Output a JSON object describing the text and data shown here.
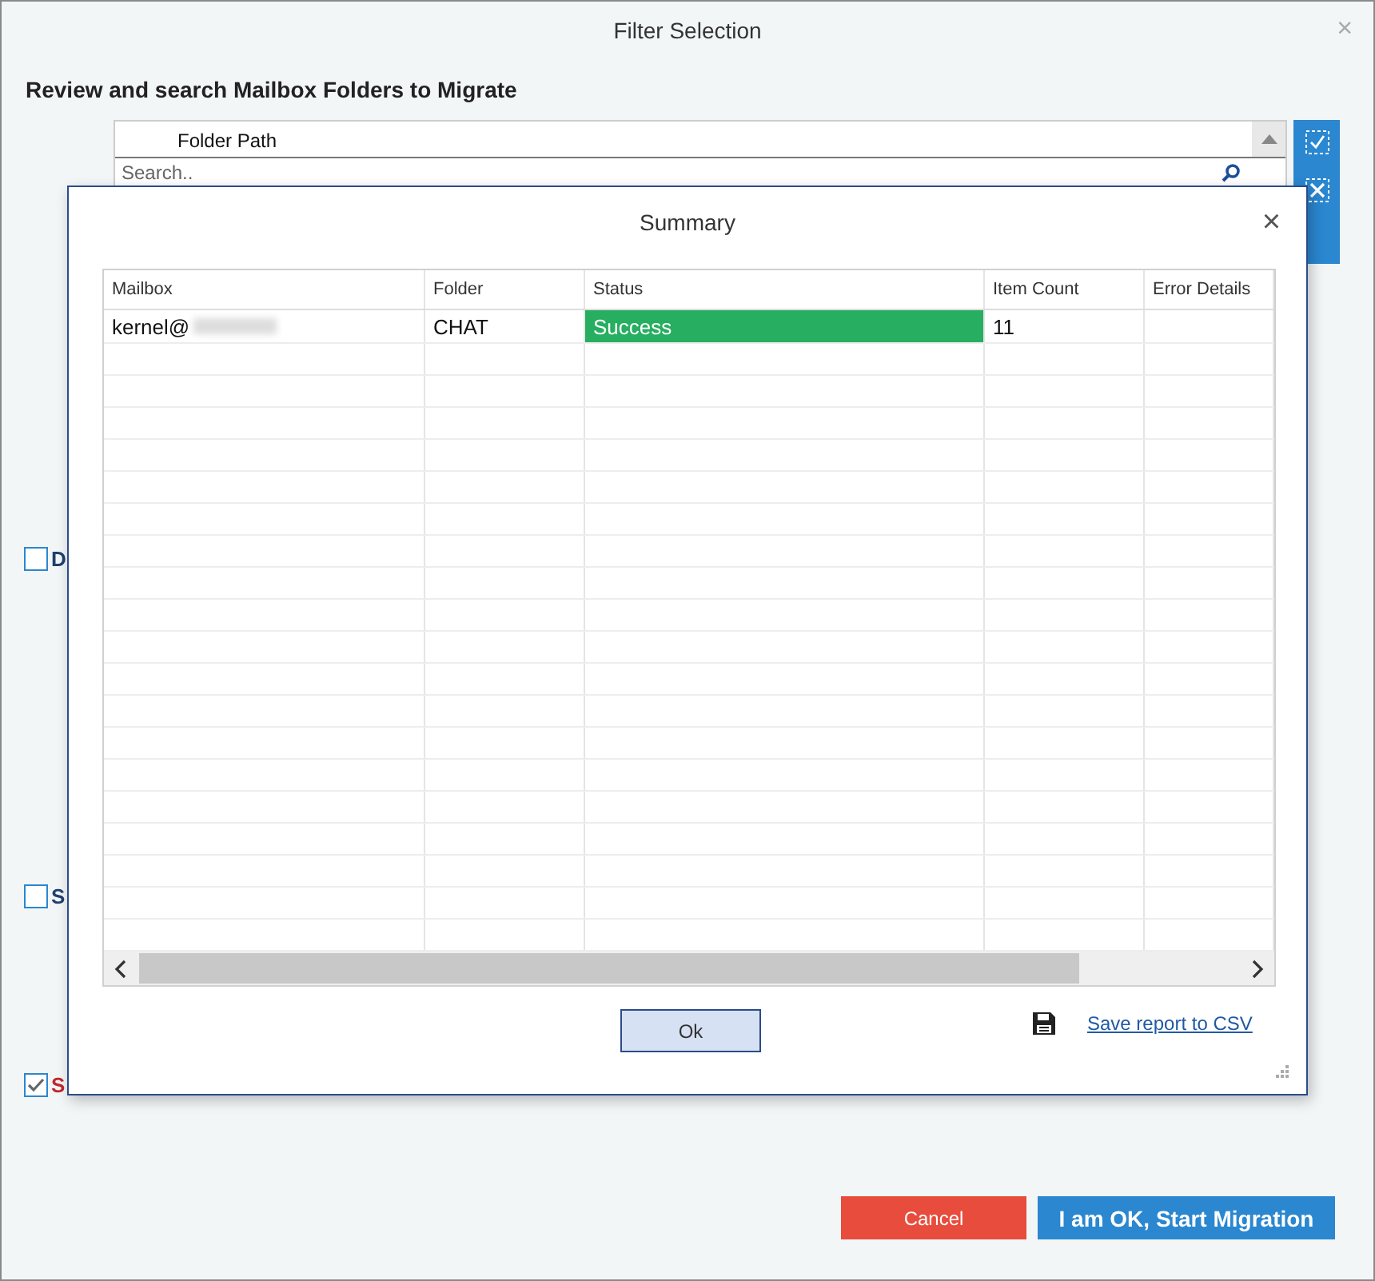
{
  "window": {
    "title": "Filter Selection",
    "close": "×"
  },
  "heading": "Review and search Mailbox Folders to Migrate",
  "folder_panel": {
    "column": "Folder Path",
    "search": {
      "placeholder": "Search.."
    }
  },
  "options": [
    {
      "label": "D",
      "checked": false,
      "kind": "normal"
    },
    {
      "label": "S",
      "checked": false,
      "kind": "normal"
    },
    {
      "label": "S",
      "checked": true,
      "kind": "warning"
    }
  ],
  "dialog": {
    "title": "Summary",
    "close": "×",
    "columns": [
      "Mailbox",
      "Folder",
      "Status",
      "Item Count",
      "Error Details"
    ],
    "rows": [
      {
        "mailbox": "kernel@",
        "folder": "CHAT",
        "status": "Success",
        "color": "#27ae60",
        "item_count": "11"
      }
    ],
    "ok_button": "Ok",
    "save_link": "Save report to CSV"
  },
  "buttons": [
    {
      "label": "Cancel",
      "kind": "cancel"
    },
    {
      "label": "I am OK, Start Migration",
      "kind": "primary"
    }
  ]
}
